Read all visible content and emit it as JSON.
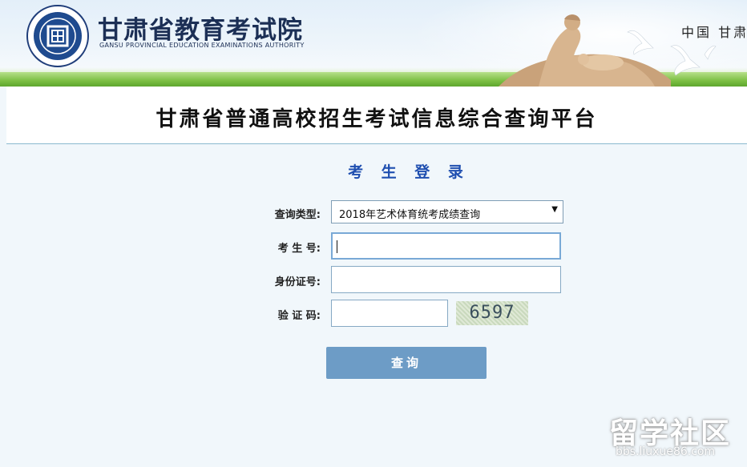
{
  "header": {
    "logo_text": "甘肃省教育考试院",
    "org_name_cn": "甘肃省教育考试院",
    "org_name_en": "GANSU PROVINCIAL EDUCATION EXAMINATIONS AUTHORITY",
    "top_right_text": "中国 甘肃",
    "logo_icon": "exam-authority-seal-icon"
  },
  "title": {
    "platform": "甘肃省普通高校招生考试信息综合查询平台"
  },
  "login": {
    "heading": "考 生 登 录",
    "query_type_label": "查询类型:",
    "query_type_value": "2018年艺术体育统考成绩查询",
    "candidate_no_label": "考 生 号:",
    "candidate_no_value": "",
    "id_label": "身份证号:",
    "id_value": "",
    "captcha_label": "验 证 码:",
    "captcha_input_value": "",
    "captcha_text": "6597",
    "submit_label": "查询"
  },
  "watermark": {
    "logo_text": "留学社区",
    "url": "bbs.liuxue86.com"
  },
  "colors": {
    "heading_blue": "#1f4fb0",
    "button_blue": "#6d9cc6",
    "page_background": "#f1f7fb"
  }
}
